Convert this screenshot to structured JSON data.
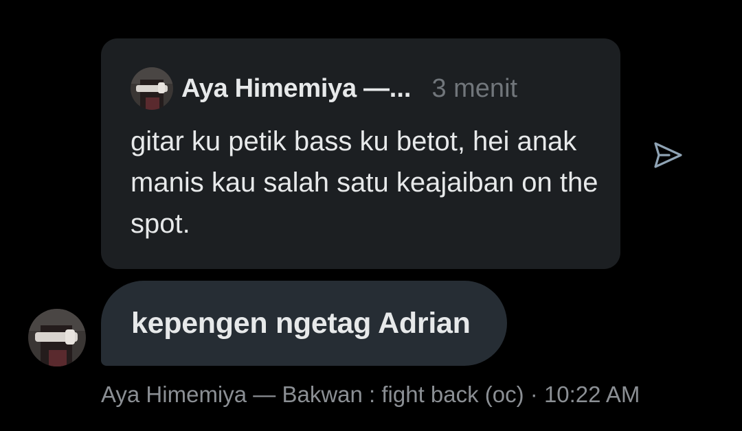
{
  "quoted_post": {
    "author": "Aya Himemiya —",
    "ellipsis": "...",
    "time": "3 menit",
    "text": "gitar ku petik bass ku betot, hei anak manis kau salah satu keajaiban on the spot."
  },
  "message": {
    "text": "kepengen ngetag Adrian"
  },
  "meta": {
    "sender": "Aya Himemiya — Bakwan : fight back (oc)",
    "separator": " · ",
    "time": "10:22 AM"
  },
  "icons": {
    "share": "send-icon",
    "avatar": "user-avatar"
  },
  "colors": {
    "background": "#000000",
    "quoted_card": "#1c1f22",
    "bubble": "#262d34",
    "text_primary": "#e7e9ea",
    "text_secondary": "#71767b",
    "icon": "#8fa3b4"
  }
}
